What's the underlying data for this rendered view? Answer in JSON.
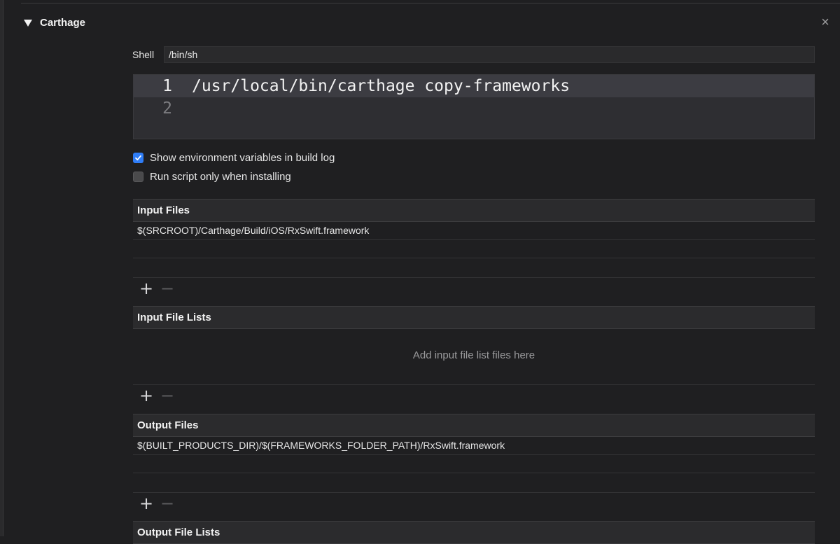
{
  "phase": {
    "title": "Carthage"
  },
  "shell": {
    "label": "Shell",
    "value": "/bin/sh"
  },
  "script": {
    "lines": [
      {
        "number": "1",
        "text": "/usr/local/bin/carthage copy-frameworks"
      },
      {
        "number": "2",
        "text": ""
      }
    ]
  },
  "options": {
    "show_env_vars": {
      "label": "Show environment variables in build log",
      "checked": true
    },
    "run_when_installing": {
      "label": "Run script only when installing",
      "checked": false
    }
  },
  "input_files": {
    "header": "Input Files",
    "rows": [
      "$(SRCROOT)/Carthage/Build/iOS/RxSwift.framework",
      ""
    ]
  },
  "input_file_lists": {
    "header": "Input File Lists",
    "placeholder": "Add input file list files here"
  },
  "output_files": {
    "header": "Output Files",
    "rows": [
      "$(BUILT_PRODUCTS_DIR)/$(FRAMEWORKS_FOLDER_PATH)/RxSwift.framework",
      ""
    ]
  },
  "output_file_lists": {
    "header": "Output File Lists"
  },
  "buttons": {
    "add": "+",
    "remove": "−"
  },
  "icons": {
    "disclosure": "disclosure-triangle-down-icon",
    "close": "close-icon",
    "check": "checkmark-icon"
  },
  "colors": {
    "background": "#1f1f21",
    "accent": "#2f7df7",
    "editor_bg": "#2e2e32",
    "editor_active_line": "#3c3c42"
  }
}
